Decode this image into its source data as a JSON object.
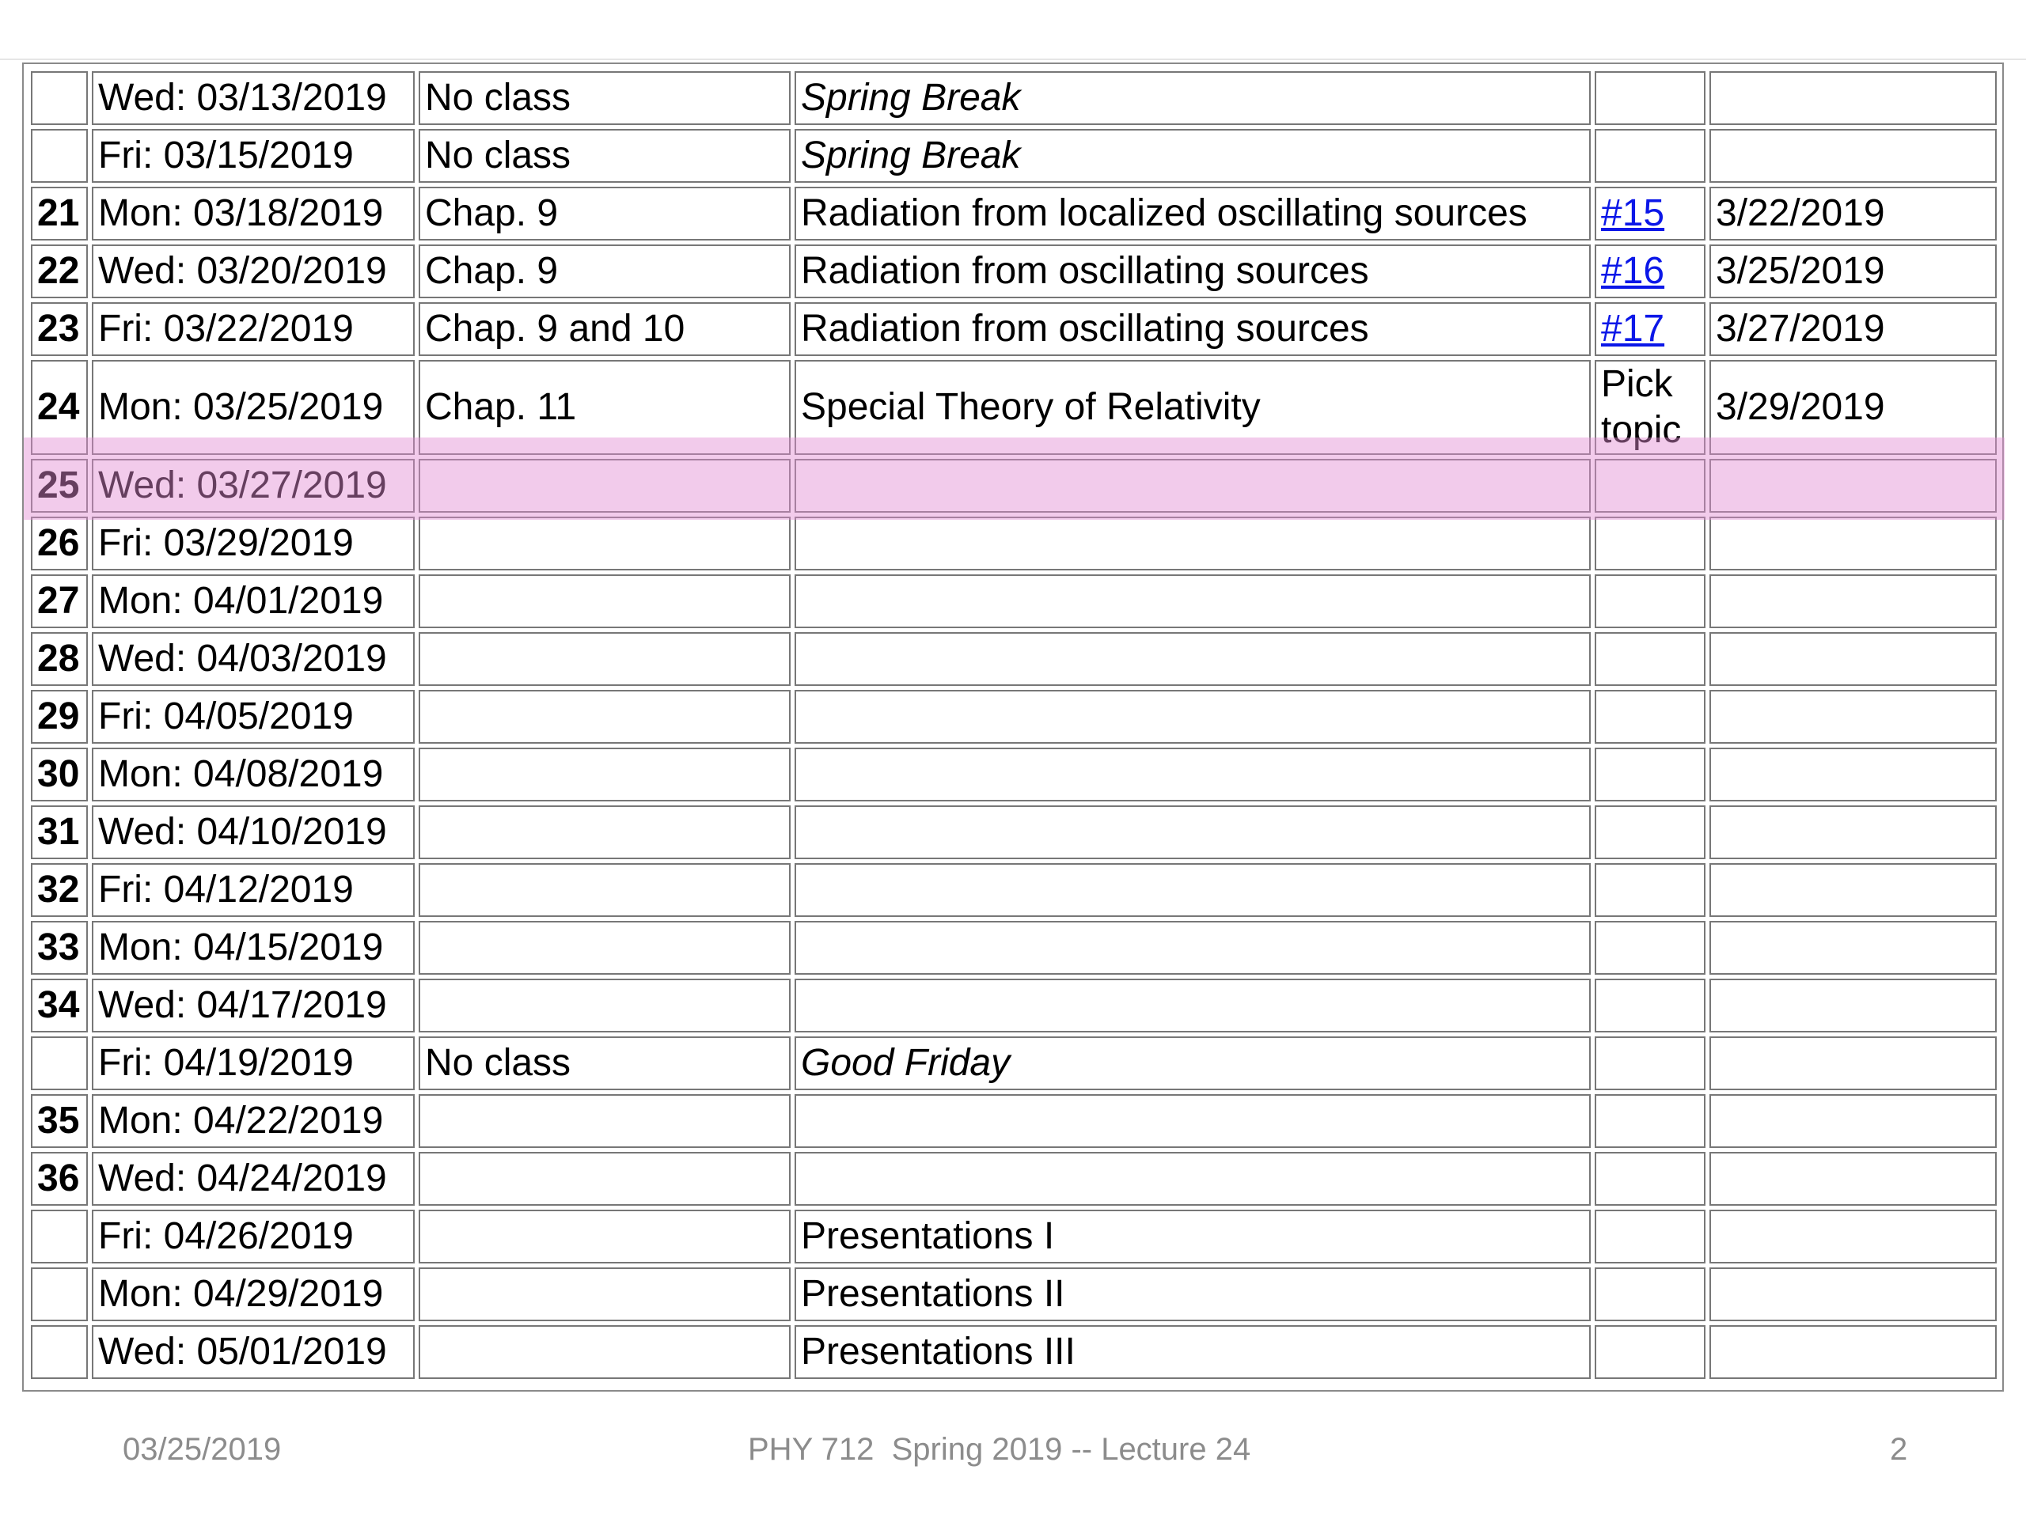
{
  "rows": [
    {
      "num": "",
      "date": "Wed: 03/13/2019",
      "reading": "No class",
      "topic": "Spring Break",
      "italic": true,
      "hw": "",
      "hw_link": false,
      "due": ""
    },
    {
      "num": "",
      "date": "Fri: 03/15/2019",
      "reading": "No class",
      "topic": "Spring Break",
      "italic": true,
      "hw": "",
      "hw_link": false,
      "due": ""
    },
    {
      "num": "21",
      "date": "Mon: 03/18/2019",
      "reading": "Chap. 9",
      "topic": "Radiation from localized oscillating sources",
      "italic": false,
      "hw": "#15",
      "hw_link": true,
      "due": "3/22/2019"
    },
    {
      "num": "22",
      "date": "Wed: 03/20/2019",
      "reading": "Chap. 9",
      "topic": "Radiation from oscillating sources",
      "italic": false,
      "hw": "#16",
      "hw_link": true,
      "due": "3/25/2019"
    },
    {
      "num": "23",
      "date": "Fri: 03/22/2019",
      "reading": "Chap. 9 and 10",
      "topic": "Radiation from oscillating sources",
      "italic": false,
      "hw": "#17",
      "hw_link": true,
      "due": "3/27/2019"
    },
    {
      "num": "24",
      "date": "Mon: 03/25/2019",
      "reading": "Chap. 11",
      "topic": "Special Theory of Relativity",
      "italic": false,
      "hw": "Pick topic",
      "hw_link": false,
      "due": "3/29/2019",
      "highlighted": true
    },
    {
      "num": "25",
      "date": "Wed: 03/27/2019",
      "reading": "",
      "topic": "",
      "italic": false,
      "hw": "",
      "hw_link": false,
      "due": ""
    },
    {
      "num": "26",
      "date": "Fri: 03/29/2019",
      "reading": "",
      "topic": "",
      "italic": false,
      "hw": "",
      "hw_link": false,
      "due": ""
    },
    {
      "num": "27",
      "date": "Mon: 04/01/2019",
      "reading": "",
      "topic": "",
      "italic": false,
      "hw": "",
      "hw_link": false,
      "due": ""
    },
    {
      "num": "28",
      "date": "Wed: 04/03/2019",
      "reading": "",
      "topic": "",
      "italic": false,
      "hw": "",
      "hw_link": false,
      "due": ""
    },
    {
      "num": "29",
      "date": "Fri: 04/05/2019",
      "reading": "",
      "topic": "",
      "italic": false,
      "hw": "",
      "hw_link": false,
      "due": ""
    },
    {
      "num": "30",
      "date": "Mon: 04/08/2019",
      "reading": "",
      "topic": "",
      "italic": false,
      "hw": "",
      "hw_link": false,
      "due": ""
    },
    {
      "num": "31",
      "date": "Wed: 04/10/2019",
      "reading": "",
      "topic": "",
      "italic": false,
      "hw": "",
      "hw_link": false,
      "due": ""
    },
    {
      "num": "32",
      "date": "Fri: 04/12/2019",
      "reading": "",
      "topic": "",
      "italic": false,
      "hw": "",
      "hw_link": false,
      "due": ""
    },
    {
      "num": "33",
      "date": "Mon: 04/15/2019",
      "reading": "",
      "topic": "",
      "italic": false,
      "hw": "",
      "hw_link": false,
      "due": ""
    },
    {
      "num": "34",
      "date": "Wed: 04/17/2019",
      "reading": "",
      "topic": "",
      "italic": false,
      "hw": "",
      "hw_link": false,
      "due": ""
    },
    {
      "num": "",
      "date": "Fri: 04/19/2019",
      "reading": "No class",
      "topic": "Good Friday",
      "italic": true,
      "hw": "",
      "hw_link": false,
      "due": ""
    },
    {
      "num": "35",
      "date": "Mon: 04/22/2019",
      "reading": "",
      "topic": "",
      "italic": false,
      "hw": "",
      "hw_link": false,
      "due": ""
    },
    {
      "num": "36",
      "date": "Wed: 04/24/2019",
      "reading": "",
      "topic": "",
      "italic": false,
      "hw": "",
      "hw_link": false,
      "due": ""
    },
    {
      "num": "",
      "date": "Fri: 04/26/2019",
      "reading": "",
      "topic": "Presentations I",
      "italic": false,
      "hw": "",
      "hw_link": false,
      "due": ""
    },
    {
      "num": "",
      "date": "Mon: 04/29/2019",
      "reading": "",
      "topic": "Presentations II",
      "italic": false,
      "hw": "",
      "hw_link": false,
      "due": ""
    },
    {
      "num": "",
      "date": "Wed: 05/01/2019",
      "reading": "",
      "topic": "Presentations III",
      "italic": false,
      "hw": "",
      "hw_link": false,
      "due": ""
    }
  ],
  "footer": {
    "date": "03/25/2019",
    "title": "PHY 712  Spring 2019 -- Lecture 24",
    "page": "2"
  },
  "colors": {
    "link": "#0b17e8",
    "highlight": "#e28cd2",
    "footer_text": "#8c8c8c"
  }
}
